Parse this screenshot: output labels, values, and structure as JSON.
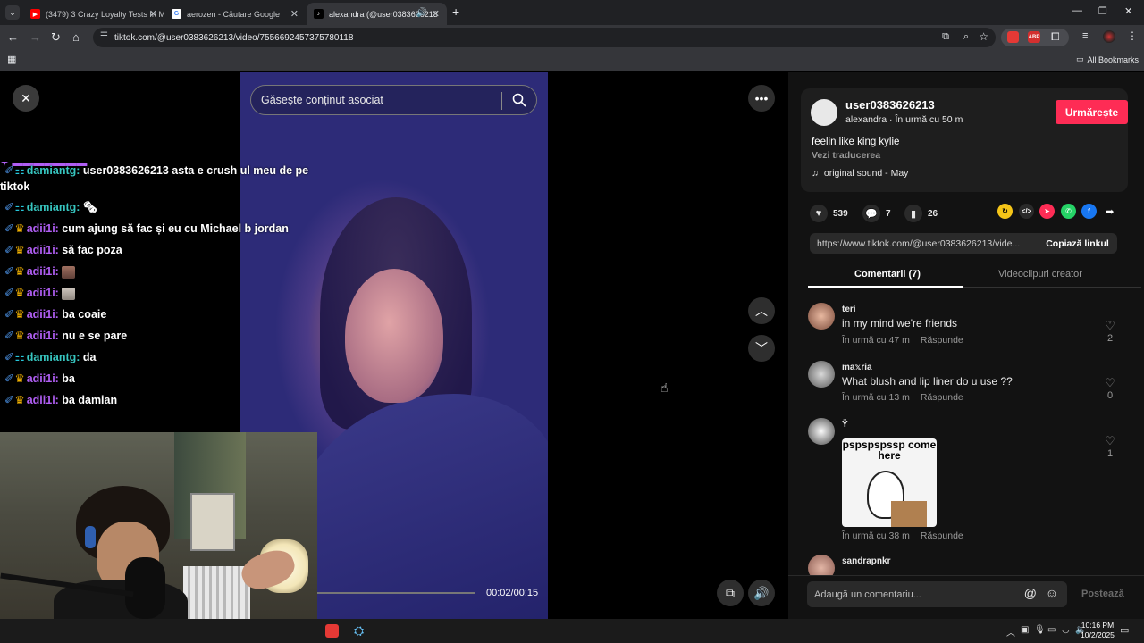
{
  "browser": {
    "tabs": [
      {
        "title": "(3479) 3 Crazy Loyalty Tests In M",
        "active": false,
        "favicon": "youtube-icon"
      },
      {
        "title": "aerozen - Căutare Google",
        "active": false,
        "favicon": "google-icon"
      },
      {
        "title": "alexandra (@user0383626213",
        "active": true,
        "favicon": "tiktok-icon"
      }
    ],
    "url": "tiktok.com/@user0383626213/video/7556692457375780118",
    "bookmarks_label": "All Bookmarks"
  },
  "video": {
    "search_placeholder": "Găsește conținut asociat",
    "time": "00:02/00:15"
  },
  "chat": {
    "messages": [
      {
        "user": "damiantg:",
        "text": "user0383626213 asta e crush ul meu de pe",
        "cont": "tiktok",
        "color": "#37c6c0"
      },
      {
        "user": "damiantg:",
        "text": "🗞",
        "color": "#37c6c0"
      },
      {
        "user": "adii1i:",
        "text": "cum ajung să fac și eu cu Michael b jordan",
        "color": "#b05ef3"
      },
      {
        "user": "adii1i:",
        "text": "să fac poza",
        "color": "#b05ef3"
      },
      {
        "user": "adii1i:",
        "text": "",
        "color": "#b05ef3"
      },
      {
        "user": "adii1i:",
        "text": "",
        "color": "#b05ef3"
      },
      {
        "user": "adii1i:",
        "text": "ba coaie",
        "color": "#b05ef3"
      },
      {
        "user": "adii1i:",
        "text": "nu e se pare",
        "color": "#b05ef3"
      },
      {
        "user": "damiantg:",
        "text": "da",
        "color": "#37c6c0"
      },
      {
        "user": "adii1i:",
        "text": "ba",
        "color": "#b05ef3"
      },
      {
        "user": "adii1i:",
        "text": "ba damian",
        "color": "#b05ef3"
      }
    ]
  },
  "post": {
    "username": "user0383626213",
    "subtitle": "alexandra · În urmă cu 50 m",
    "follow_label": "Urmărește",
    "caption": "feelin like king kylie",
    "translate_label": "Vezi traducerea",
    "sound": "original sound - May",
    "likes": "539",
    "comments": "7",
    "saves": "26",
    "link": "https://www.tiktok.com/@user0383626213/vide...",
    "copy_label": "Copiază linkul"
  },
  "panel_tabs": {
    "comments": "Comentarii (7)",
    "creator_videos": "Videoclipuri creator"
  },
  "comments": [
    {
      "name": "teri",
      "text": "in my mind we're friends",
      "time": "În urmă cu 47 m",
      "reply": "Răspunde",
      "likes": "2"
    },
    {
      "name": "ma𝕩ria",
      "text": "What blush and lip liner do u use ??",
      "time": "În urmă cu 13 m",
      "reply": "Răspunde",
      "likes": "0"
    },
    {
      "name": "Ÿ",
      "sticker_text": "pspspspssp come here",
      "time": "În urmă cu 38 m",
      "reply": "Răspunde",
      "likes": "1"
    },
    {
      "name": "sandrapnkr"
    }
  ],
  "comment_bar": {
    "placeholder": "Adaugă un comentariu...",
    "post_label": "Postează"
  },
  "taskbar": {
    "time": "10:16 PM",
    "date": "10/2/2025"
  },
  "colors": {
    "accent": "#fe2c55",
    "panel_bg": "#121212"
  }
}
